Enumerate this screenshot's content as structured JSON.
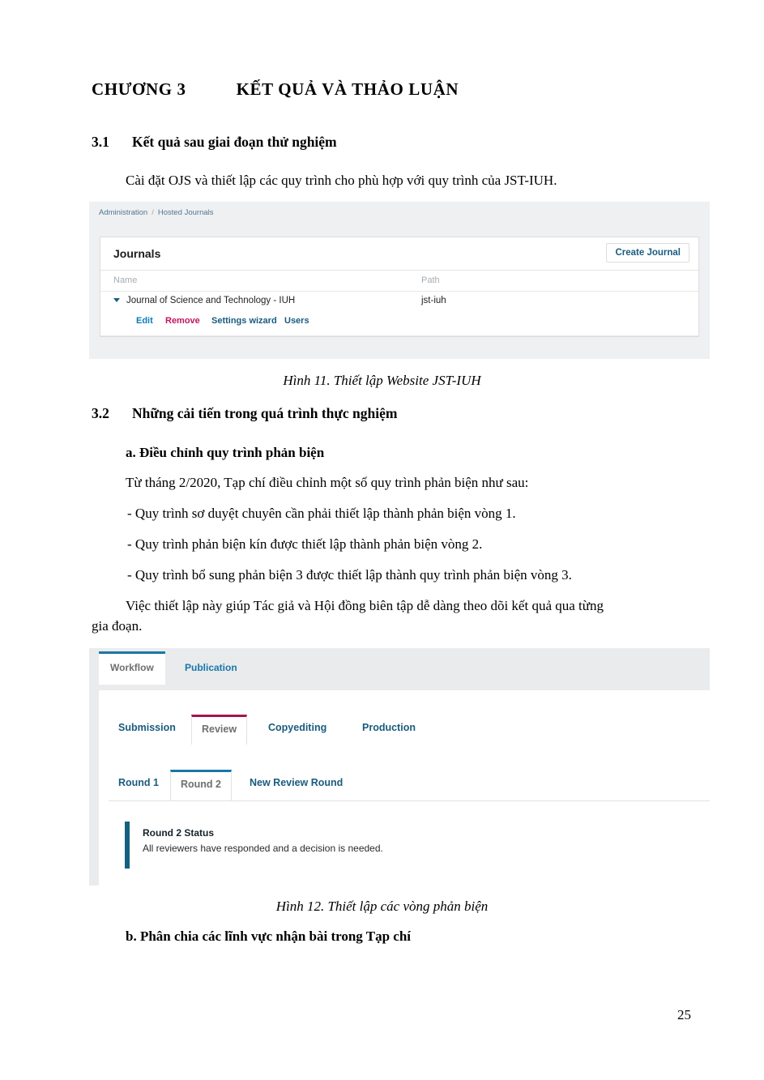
{
  "document": {
    "chapter_label": "CHƯƠNG 3",
    "chapter_title": "KẾT QUẢ VÀ THẢO LUẬN",
    "page_number": "25",
    "sections": {
      "s31_num": "3.1",
      "s31_title": "Kết quả sau giai đoạn thử nghiệm",
      "s31_para": "Cài đặt OJS và thiết lập các quy trình cho phù hợp với quy trình của JST-IUH.",
      "s32_num": "3.2",
      "s32_title": "Những cải tiến trong quá trình thực nghiệm",
      "sub_a_title": "a. Điều chỉnh quy trình phản biện",
      "sub_a_intro": "Từ tháng 2/2020, Tạp chí điều chỉnh một số quy trình phản biện như sau:",
      "bullet_1": "- Quy trình sơ duyệt chuyên cần phải thiết lập thành phản biện vòng 1.",
      "bullet_2": "- Quy trình phản biện kín được thiết lập thành phản biện vòng 2.",
      "bullet_3": "- Quy trình bổ sung phản biện 3 được thiết lập thành quy trình phản biện vòng 3.",
      "closing_line_1": "Việc thiết lập này giúp Tác giả và Hội đồng biên tập dễ dàng theo dõi kết quả qua từng",
      "closing_line_2": "gia đoạn.",
      "sub_b_title": "b. Phân chia các lĩnh vực nhận bài trong Tạp chí"
    },
    "captions": {
      "figure_11": "Hình 11. Thiết lập Website JST-IUH",
      "figure_12": "Hình 12. Thiết lập các vòng phản biện"
    }
  },
  "figure11": {
    "breadcrumb": {
      "root": "Administration",
      "separator": "/",
      "current": "Hosted Journals"
    },
    "card_title": "Journals",
    "create_button": "Create Journal",
    "columns": {
      "name": "Name",
      "path": "Path"
    },
    "rows": [
      {
        "name": "Journal of Science and Technology - IUH",
        "path": "jst-iuh",
        "caret_icon": "caret-down-icon"
      }
    ],
    "row_actions": {
      "edit": "Edit",
      "remove": "Remove",
      "settings_wizard": "Settings wizard",
      "users": "Users"
    },
    "colors": {
      "link": "#1a5b7f",
      "edit_link": "#0a7bb5",
      "danger_link": "#c0165f",
      "page_bg": "#eff0f1"
    }
  },
  "figure12": {
    "top_tabs": [
      {
        "label": "Workflow",
        "active": true
      },
      {
        "label": "Publication",
        "active": false
      }
    ],
    "stage_tabs": [
      {
        "label": "Submission",
        "active": false
      },
      {
        "label": "Review",
        "active": true
      },
      {
        "label": "Copyediting",
        "active": false
      },
      {
        "label": "Production",
        "active": false
      }
    ],
    "round_tabs": [
      {
        "label": "Round 1",
        "active": false
      },
      {
        "label": "Round 2",
        "active": true
      },
      {
        "label": "New Review Round",
        "active": false
      }
    ],
    "status": {
      "title": "Round 2 Status",
      "description": "All reviewers have responded and a decision is needed."
    },
    "colors": {
      "workflow_accent": "#1a76a8",
      "review_accent": "#a5144f",
      "status_accent": "#16607f",
      "header_bg": "#e9ebec"
    }
  }
}
